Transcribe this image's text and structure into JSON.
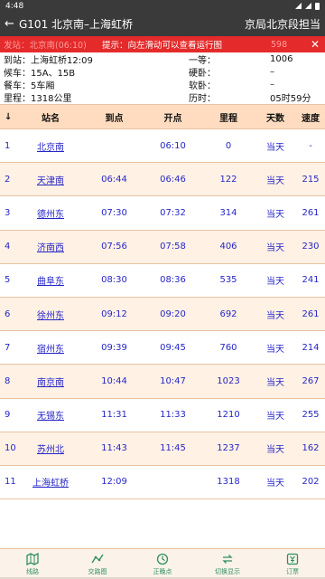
{
  "status_bar": {
    "time": "4:48"
  },
  "app_bar": {
    "back_glyph": "←",
    "title": "G101 北京南–上海虹桥",
    "bureau": "京局北京段担当"
  },
  "notice": {
    "left_text": "发站：北京南(06:10)",
    "tip": "提示：向左滑动可以查看运行图",
    "right_number": "598",
    "close_glyph": "✕"
  },
  "info": {
    "rows": [
      {
        "c1": "到站：上海虹桥12:09",
        "c2": "一等：",
        "c3": "1006"
      },
      {
        "c1": "候车：15A、15B",
        "c2": "硬卧：",
        "c3": "–"
      },
      {
        "c1": "餐车：5车厢",
        "c2": "软卧：",
        "c3": "–"
      },
      {
        "c1": "里程：1318公里",
        "c2": "历时：",
        "c3": "05时59分"
      }
    ]
  },
  "table": {
    "headers": {
      "idx": "↓",
      "name": "站名",
      "arrive": "到点",
      "depart": "开点",
      "km": "里程",
      "day": "天数",
      "speed": "速度"
    },
    "rows": [
      {
        "idx": "1",
        "name": "北京南",
        "arrive": "",
        "depart": "06:10",
        "km": "0",
        "day": "当天",
        "speed": "-"
      },
      {
        "idx": "2",
        "name": "天津南",
        "arrive": "06:44",
        "depart": "06:46",
        "km": "122",
        "day": "当天",
        "speed": "215"
      },
      {
        "idx": "3",
        "name": "德州东",
        "arrive": "07:30",
        "depart": "07:32",
        "km": "314",
        "day": "当天",
        "speed": "261"
      },
      {
        "idx": "4",
        "name": "济南西",
        "arrive": "07:56",
        "depart": "07:58",
        "km": "406",
        "day": "当天",
        "speed": "230"
      },
      {
        "idx": "5",
        "name": "曲阜东",
        "arrive": "08:30",
        "depart": "08:36",
        "km": "535",
        "day": "当天",
        "speed": "241"
      },
      {
        "idx": "6",
        "name": "徐州东",
        "arrive": "09:12",
        "depart": "09:20",
        "km": "692",
        "day": "当天",
        "speed": "261"
      },
      {
        "idx": "7",
        "name": "宿州东",
        "arrive": "09:39",
        "depart": "09:45",
        "km": "760",
        "day": "当天",
        "speed": "214"
      },
      {
        "idx": "8",
        "name": "南京南",
        "arrive": "10:44",
        "depart": "10:47",
        "km": "1023",
        "day": "当天",
        "speed": "267"
      },
      {
        "idx": "9",
        "name": "无锡东",
        "arrive": "11:31",
        "depart": "11:33",
        "km": "1210",
        "day": "当天",
        "speed": "255"
      },
      {
        "idx": "10",
        "name": "苏州北",
        "arrive": "11:43",
        "depart": "11:45",
        "km": "1237",
        "day": "当天",
        "speed": "162"
      },
      {
        "idx": "11",
        "name": "上海虹桥",
        "arrive": "12:09",
        "depart": "",
        "km": "1318",
        "day": "当天",
        "speed": "202"
      }
    ]
  },
  "bottom_nav": {
    "items": [
      {
        "label": "线路",
        "icon": "map-icon"
      },
      {
        "label": "交路图",
        "icon": "route-chart-icon"
      },
      {
        "label": "正晚点",
        "icon": "clock-icon"
      },
      {
        "label": "切换显示",
        "icon": "switch-icon"
      },
      {
        "label": "订票",
        "icon": "ticket-icon"
      }
    ]
  },
  "colors": {
    "header_bg": "#3a3a3a",
    "notice_bg": "#e42a2a",
    "table_head_bg": "#ffdcbf",
    "link_blue": "#2626c8",
    "nav_green": "#2f8f5f"
  }
}
